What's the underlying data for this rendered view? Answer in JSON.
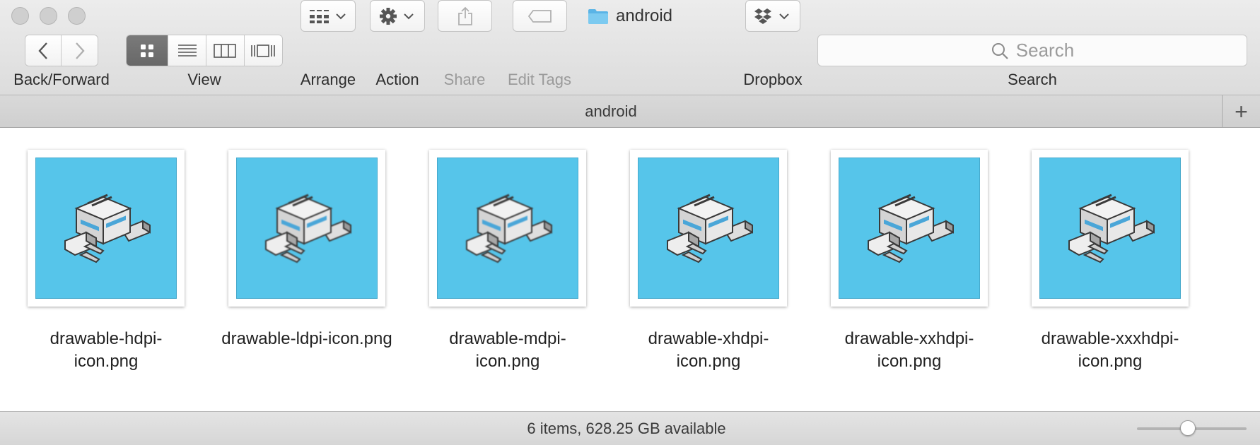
{
  "window": {
    "title": "android",
    "title_icon": "folder-icon",
    "accent_folder_color": "#5ab4e6"
  },
  "toolbar": {
    "back_forward_label": "Back/Forward",
    "view_label": "View",
    "arrange_label": "Arrange",
    "action_label": "Action",
    "share_label": "Share",
    "edit_tags_label": "Edit Tags",
    "dropbox_label": "Dropbox",
    "search_label": "Search",
    "search_placeholder": "Search",
    "active_view": "icon"
  },
  "pathbar": {
    "tab_title": "android",
    "new_tab_symbol": "+"
  },
  "files": [
    {
      "name": "drawable-hdpi-\nicon.png",
      "style": "sharp"
    },
    {
      "name": "drawable-ldpi-icon.png",
      "style": "pixelated"
    },
    {
      "name": "drawable-mdpi-\nicon.png",
      "style": "pixelated"
    },
    {
      "name": "drawable-xhdpi-\nicon.png",
      "style": "sharp"
    },
    {
      "name": "drawable-xxhdpi-\nicon.png",
      "style": "sharp"
    },
    {
      "name": "drawable-xxxhdpi-\nicon.png",
      "style": "sharp"
    }
  ],
  "thumbnail_bg_color": "#56c5ea",
  "status": {
    "text": "6 items, 628.25 GB available",
    "icon_size_slider": 0.4
  }
}
